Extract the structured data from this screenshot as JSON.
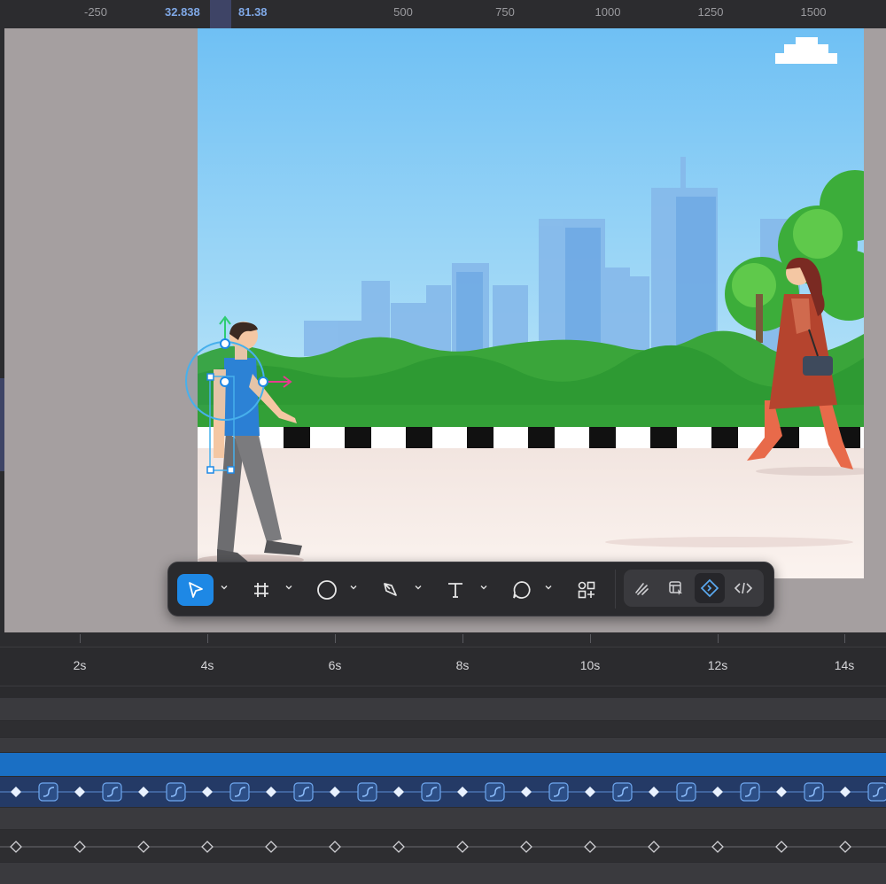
{
  "ruler": {
    "ticks": [
      "-250",
      "500",
      "750",
      "1000",
      "1250",
      "1500"
    ],
    "selection_start": "32.838",
    "selection_end": "81.38"
  },
  "toolbar": {
    "tools": [
      "move-tool",
      "frame-tool",
      "shape-tool",
      "pen-tool",
      "text-tool",
      "comment-tool",
      "components-tool"
    ],
    "mode_tools": [
      "draw-mode",
      "design-mode",
      "prototype-mode",
      "dev-mode"
    ],
    "active_tool": "move-tool",
    "active_mode": "prototype-mode"
  },
  "timeline": {
    "labels": [
      "2s",
      "4s",
      "6s",
      "8s",
      "10s",
      "12s",
      "14s"
    ]
  },
  "colors": {
    "accent": "#1e88e5",
    "selected_track": "#1a6fc4",
    "keyframe_track": "#243a66"
  }
}
